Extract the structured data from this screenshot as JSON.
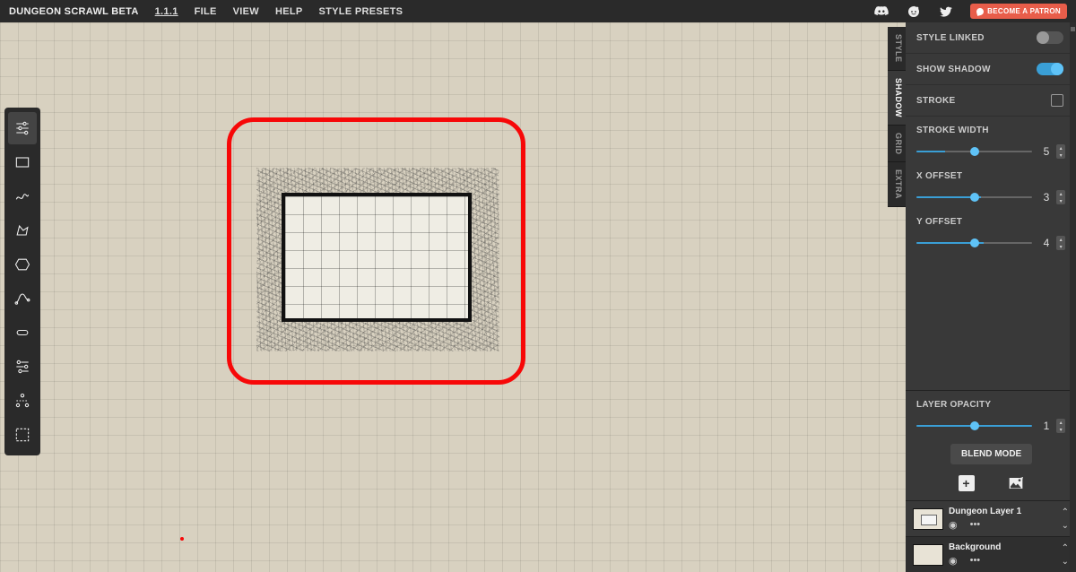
{
  "header": {
    "brand": "DUNGEON SCRAWL BETA",
    "version": "1.1.1",
    "menu": [
      "FILE",
      "VIEW",
      "HELP",
      "STYLE PRESETS"
    ],
    "patron_label": "BECOME A PATRON"
  },
  "side_tabs": [
    "STYLE",
    "SHADOW",
    "GRID",
    "EXTRA"
  ],
  "properties": {
    "style_linked": {
      "label": "STYLE LINKED",
      "on": false
    },
    "show_shadow": {
      "label": "SHOW SHADOW",
      "on": true
    },
    "stroke": {
      "label": "STROKE",
      "checked": false
    },
    "stroke_width": {
      "label": "STROKE WIDTH",
      "value": "5",
      "fill": "25%"
    },
    "x_offset": {
      "label": "X OFFSET",
      "value": "3",
      "fill": "56%"
    },
    "y_offset": {
      "label": "Y OFFSET",
      "value": "4",
      "fill": "58%"
    },
    "layer_opacity": {
      "label": "LAYER OPACITY",
      "value": "1",
      "fill": "100%"
    },
    "blend_mode": "BLEND MODE"
  },
  "layers": [
    {
      "name": "Dungeon Layer 1"
    },
    {
      "name": "Background"
    }
  ]
}
